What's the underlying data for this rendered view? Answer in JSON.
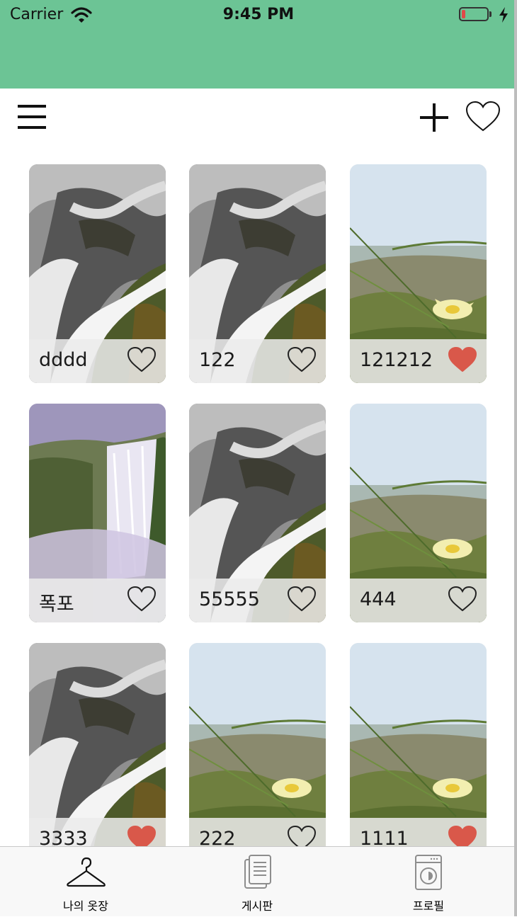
{
  "status_bar": {
    "carrier": "Carrier",
    "time": "9:45 PM",
    "battery_level": 0.15
  },
  "colors": {
    "header_green": "#6cc495",
    "heart_filled": "#d9584a",
    "tab_active": "#111111",
    "tab_inactive": "#9a9a9a"
  },
  "nav": {
    "menu_icon": "hamburger-menu-icon",
    "add_icon": "plus-icon",
    "favorites_icon": "heart-outline-icon"
  },
  "cards": [
    {
      "name": "dddd",
      "image": "waterfall-rocks",
      "liked": false
    },
    {
      "name": "122",
      "image": "waterfall-rocks",
      "liked": false
    },
    {
      "name": "121212",
      "image": "flower-beach",
      "liked": true
    },
    {
      "name": "폭포",
      "image": "waterfall-mist",
      "liked": false
    },
    {
      "name": "55555",
      "image": "waterfall-rocks",
      "liked": false
    },
    {
      "name": "444",
      "image": "flower-beach",
      "liked": false
    },
    {
      "name": "3333",
      "image": "waterfall-rocks",
      "liked": true
    },
    {
      "name": "222",
      "image": "flower-beach",
      "liked": false
    },
    {
      "name": "1111",
      "image": "flower-beach",
      "liked": true
    }
  ],
  "tabs": [
    {
      "label": "나의 옷장",
      "icon": "hanger-icon",
      "active": true
    },
    {
      "label": "게시판",
      "icon": "document-icon",
      "active": false
    },
    {
      "label": "프로필",
      "icon": "washing-machine-icon",
      "active": false
    }
  ]
}
